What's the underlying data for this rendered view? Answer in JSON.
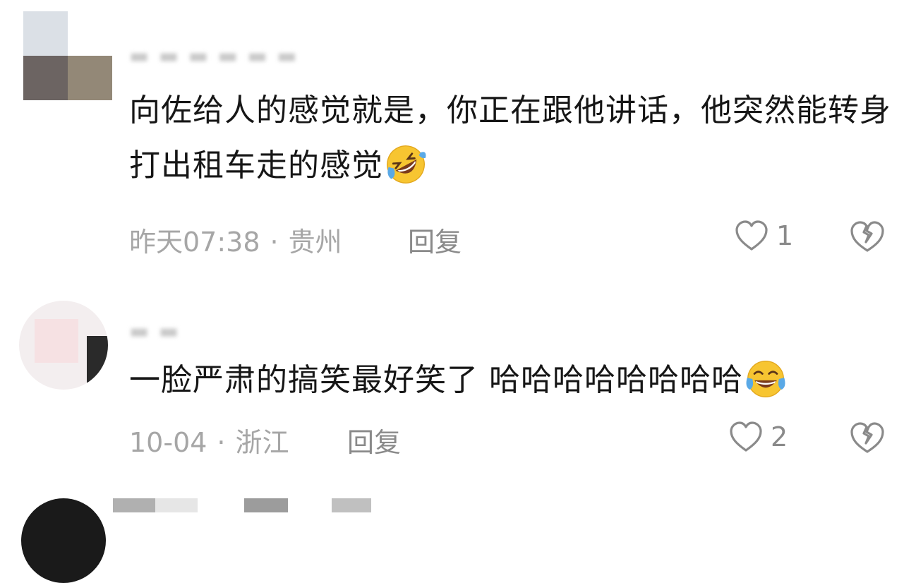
{
  "comments": [
    {
      "text": "向佐给人的感觉就是，你正在跟他讲话，他突然能转身打出租车走的感觉",
      "emoji": "rolling-laughing-emoji",
      "time": "昨天07:38",
      "separator": "·",
      "location": "贵州",
      "reply_label": "回复",
      "like_count": "1"
    },
    {
      "text": "一脸严肃的搞笑最好笑了 哈哈哈哈哈哈哈哈",
      "emoji": "tears-of-joy-emoji",
      "time": "10-04",
      "separator": "·",
      "location": "浙江",
      "reply_label": "回复",
      "like_count": "2"
    }
  ],
  "icons": {
    "like": "heart-outline-icon",
    "dislike": "broken-heart-icon"
  },
  "colors": {
    "text": "#161616",
    "meta": "#a6a6a6",
    "action": "#8a8a8a",
    "emoji_yellow": "#f7c531"
  }
}
